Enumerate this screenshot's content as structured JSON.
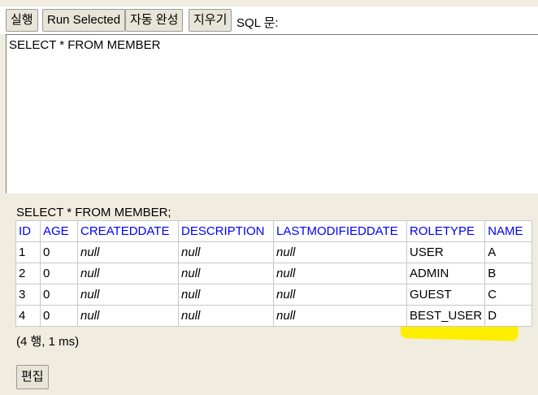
{
  "toolbar": {
    "run_label": "실행",
    "run_selected_label": "Run Selected",
    "autocomplete_label": "자동 완성",
    "clear_label": "지우기",
    "sql_label": "SQL 문:"
  },
  "editor": {
    "text": "SELECT * FROM MEMBER"
  },
  "result": {
    "query": "SELECT * FROM MEMBER;",
    "columns": [
      "ID",
      "AGE",
      "CREATEDDATE",
      "DESCRIPTION",
      "LASTMODIFIEDDATE",
      "ROLETYPE",
      "NAME"
    ],
    "rows": [
      [
        "1",
        "0",
        "null",
        "null",
        "null",
        "USER",
        "A"
      ],
      [
        "2",
        "0",
        "null",
        "null",
        "null",
        "ADMIN",
        "B"
      ],
      [
        "3",
        "0",
        "null",
        "null",
        "null",
        "GUEST",
        "C"
      ],
      [
        "4",
        "0",
        "null",
        "null",
        "null",
        "BEST_USER",
        "D"
      ]
    ],
    "row_count": "(4 행, 1 ms)",
    "edit_label": "편집"
  },
  "colors": {
    "header_text": "#0000ff",
    "highlight": "#ffee00",
    "background": "#f0ecdf"
  }
}
